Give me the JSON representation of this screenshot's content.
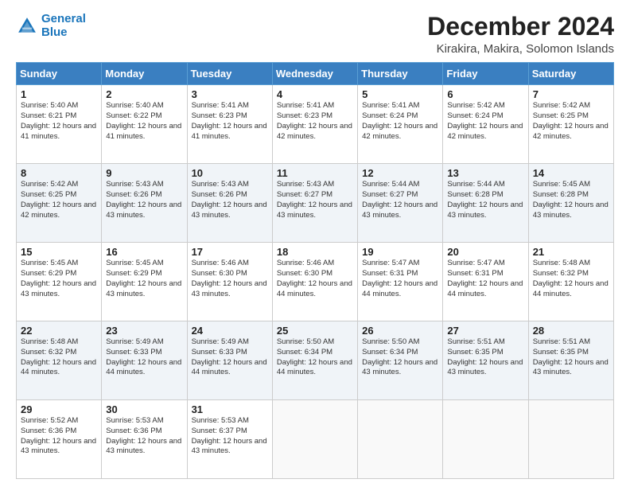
{
  "header": {
    "logo_line1": "General",
    "logo_line2": "Blue",
    "main_title": "December 2024",
    "subtitle": "Kirakira, Makira, Solomon Islands"
  },
  "calendar": {
    "days_of_week": [
      "Sunday",
      "Monday",
      "Tuesday",
      "Wednesday",
      "Thursday",
      "Friday",
      "Saturday"
    ],
    "weeks": [
      [
        {
          "day": "1",
          "sunrise": "5:40 AM",
          "sunset": "6:21 PM",
          "daylight": "12 hours and 41 minutes."
        },
        {
          "day": "2",
          "sunrise": "5:40 AM",
          "sunset": "6:22 PM",
          "daylight": "12 hours and 41 minutes."
        },
        {
          "day": "3",
          "sunrise": "5:41 AM",
          "sunset": "6:23 PM",
          "daylight": "12 hours and 41 minutes."
        },
        {
          "day": "4",
          "sunrise": "5:41 AM",
          "sunset": "6:23 PM",
          "daylight": "12 hours and 42 minutes."
        },
        {
          "day": "5",
          "sunrise": "5:41 AM",
          "sunset": "6:24 PM",
          "daylight": "12 hours and 42 minutes."
        },
        {
          "day": "6",
          "sunrise": "5:42 AM",
          "sunset": "6:24 PM",
          "daylight": "12 hours and 42 minutes."
        },
        {
          "day": "7",
          "sunrise": "5:42 AM",
          "sunset": "6:25 PM",
          "daylight": "12 hours and 42 minutes."
        }
      ],
      [
        {
          "day": "8",
          "sunrise": "5:42 AM",
          "sunset": "6:25 PM",
          "daylight": "12 hours and 42 minutes."
        },
        {
          "day": "9",
          "sunrise": "5:43 AM",
          "sunset": "6:26 PM",
          "daylight": "12 hours and 43 minutes."
        },
        {
          "day": "10",
          "sunrise": "5:43 AM",
          "sunset": "6:26 PM",
          "daylight": "12 hours and 43 minutes."
        },
        {
          "day": "11",
          "sunrise": "5:43 AM",
          "sunset": "6:27 PM",
          "daylight": "12 hours and 43 minutes."
        },
        {
          "day": "12",
          "sunrise": "5:44 AM",
          "sunset": "6:27 PM",
          "daylight": "12 hours and 43 minutes."
        },
        {
          "day": "13",
          "sunrise": "5:44 AM",
          "sunset": "6:28 PM",
          "daylight": "12 hours and 43 minutes."
        },
        {
          "day": "14",
          "sunrise": "5:45 AM",
          "sunset": "6:28 PM",
          "daylight": "12 hours and 43 minutes."
        }
      ],
      [
        {
          "day": "15",
          "sunrise": "5:45 AM",
          "sunset": "6:29 PM",
          "daylight": "12 hours and 43 minutes."
        },
        {
          "day": "16",
          "sunrise": "5:45 AM",
          "sunset": "6:29 PM",
          "daylight": "12 hours and 43 minutes."
        },
        {
          "day": "17",
          "sunrise": "5:46 AM",
          "sunset": "6:30 PM",
          "daylight": "12 hours and 43 minutes."
        },
        {
          "day": "18",
          "sunrise": "5:46 AM",
          "sunset": "6:30 PM",
          "daylight": "12 hours and 44 minutes."
        },
        {
          "day": "19",
          "sunrise": "5:47 AM",
          "sunset": "6:31 PM",
          "daylight": "12 hours and 44 minutes."
        },
        {
          "day": "20",
          "sunrise": "5:47 AM",
          "sunset": "6:31 PM",
          "daylight": "12 hours and 44 minutes."
        },
        {
          "day": "21",
          "sunrise": "5:48 AM",
          "sunset": "6:32 PM",
          "daylight": "12 hours and 44 minutes."
        }
      ],
      [
        {
          "day": "22",
          "sunrise": "5:48 AM",
          "sunset": "6:32 PM",
          "daylight": "12 hours and 44 minutes."
        },
        {
          "day": "23",
          "sunrise": "5:49 AM",
          "sunset": "6:33 PM",
          "daylight": "12 hours and 44 minutes."
        },
        {
          "day": "24",
          "sunrise": "5:49 AM",
          "sunset": "6:33 PM",
          "daylight": "12 hours and 44 minutes."
        },
        {
          "day": "25",
          "sunrise": "5:50 AM",
          "sunset": "6:34 PM",
          "daylight": "12 hours and 44 minutes."
        },
        {
          "day": "26",
          "sunrise": "5:50 AM",
          "sunset": "6:34 PM",
          "daylight": "12 hours and 43 minutes."
        },
        {
          "day": "27",
          "sunrise": "5:51 AM",
          "sunset": "6:35 PM",
          "daylight": "12 hours and 43 minutes."
        },
        {
          "day": "28",
          "sunrise": "5:51 AM",
          "sunset": "6:35 PM",
          "daylight": "12 hours and 43 minutes."
        }
      ],
      [
        {
          "day": "29",
          "sunrise": "5:52 AM",
          "sunset": "6:36 PM",
          "daylight": "12 hours and 43 minutes."
        },
        {
          "day": "30",
          "sunrise": "5:53 AM",
          "sunset": "6:36 PM",
          "daylight": "12 hours and 43 minutes."
        },
        {
          "day": "31",
          "sunrise": "5:53 AM",
          "sunset": "6:37 PM",
          "daylight": "12 hours and 43 minutes."
        },
        null,
        null,
        null,
        null
      ]
    ]
  }
}
